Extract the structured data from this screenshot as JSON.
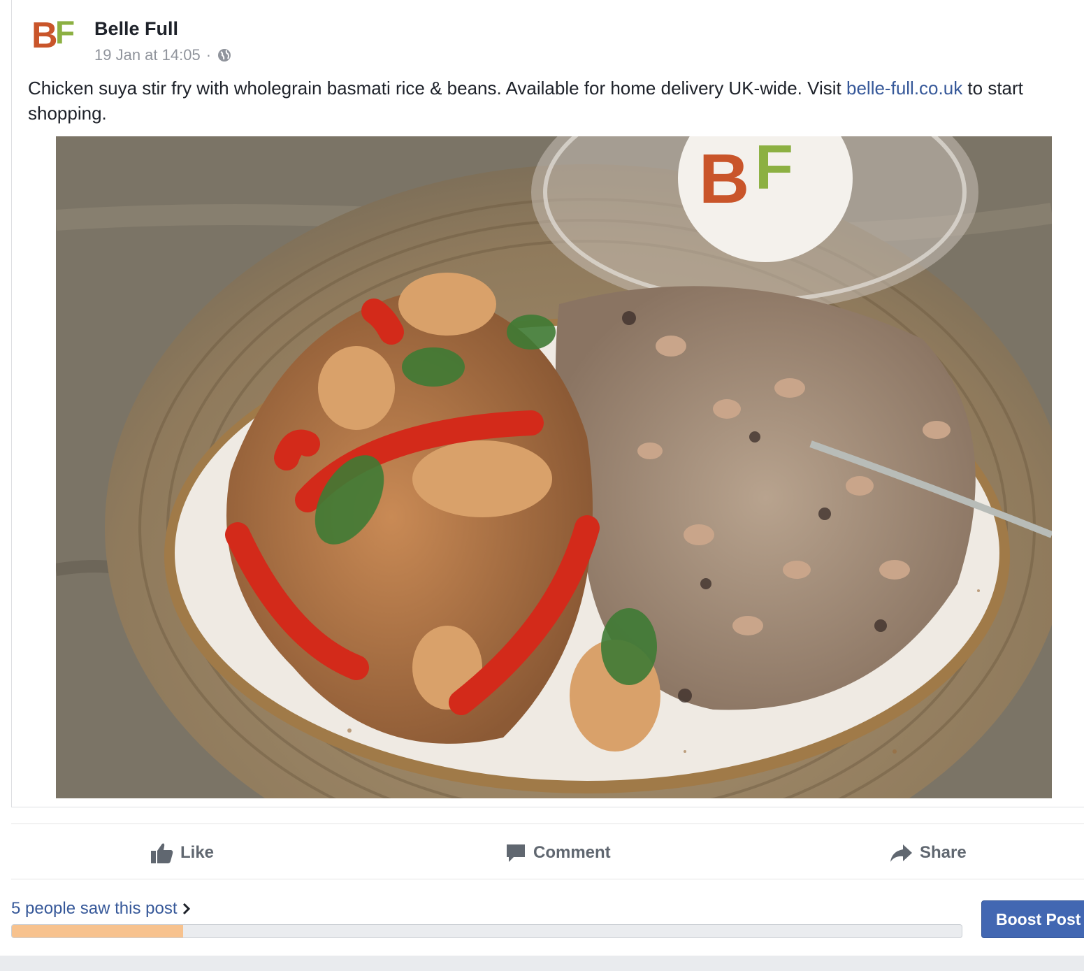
{
  "post": {
    "page_name": "Belle Full",
    "timestamp": "19 Jan at 14:05",
    "separator": "·",
    "privacy_icon": "globe-icon",
    "avatar_text": "BF",
    "message_pre": "Chicken suya stir fry with wholegrain basmati rice & beans. Available for home delivery UK-wide. Visit ",
    "message_link": "belle-full.co.uk",
    "message_post": " to start shopping.",
    "photo_alt": "Plate of chicken suya stir fry with wholegrain basmati rice and beans on a woven placemat"
  },
  "actions": {
    "like": "Like",
    "comment": "Comment",
    "share": "Share"
  },
  "insights": {
    "reach_text": "5 people saw this post",
    "reach_progress": 0.18,
    "boost_label": "Boost Post"
  },
  "colors": {
    "link": "#365899",
    "boost_button": "#4267b2",
    "progress_fill": "#f7c28e",
    "brand_orange": "#c9552a",
    "brand_green": "#8cb042"
  }
}
